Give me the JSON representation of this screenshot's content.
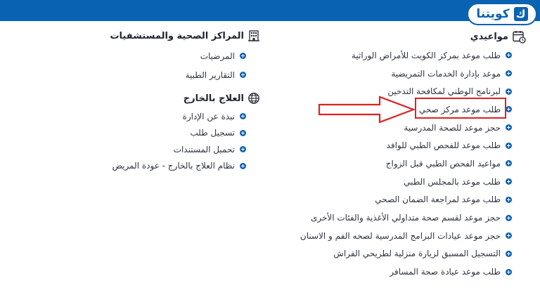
{
  "brand": {
    "logo_text": "كويتنا",
    "logo_mark": "ك",
    "primary_color": "#0a62b3"
  },
  "appointments": {
    "title": "مواعيدي",
    "icon": "calendar-icon",
    "items": [
      {
        "label": "طلب موعد بمركز الكويت للأمراض الوراثية"
      },
      {
        "label": "موعد بإدارة الخدمات التمريضية"
      },
      {
        "label": "لبرنامج الوطني لمكافحة التدخين"
      },
      {
        "label": "طلب موعد مركز صحي"
      },
      {
        "label": "حجز موعد للصحة المدرسية"
      },
      {
        "label": "طلب موعد للفحص الطبي للوافد"
      },
      {
        "label": "مواعيد الفحص الطبي قبل الزواج"
      },
      {
        "label": "طلب موعد بالمجلس الطبي"
      },
      {
        "label": "طلب موعد لمراجعة الضمان الصحي"
      },
      {
        "label": "حجز موعد لقسم صحة متداولي الأغذية والفئات الأخرى"
      },
      {
        "label": "حجز موعد عيادات البرامج المدرسية لصحه الفم و الاسنان"
      },
      {
        "label": "التسجيل المسبق لزيارة منزلية لطريحي الفراش"
      },
      {
        "label": "طلب موعد عيادة صحة المسافر"
      }
    ]
  },
  "health_centers": {
    "title": "المراكز الصحية والمستشفيات",
    "icon": "hospital-building-icon",
    "items": [
      {
        "label": "المرضيات"
      },
      {
        "label": "التقارير الطبية"
      }
    ]
  },
  "treatment_abroad": {
    "title": "العلاج بالخارج",
    "icon": "globe-icon",
    "items": [
      {
        "label": "نبذة عن الإدارة"
      },
      {
        "label": "تسجيل طلب"
      },
      {
        "label": "تحميل المستندات"
      },
      {
        "label": "نظام العلاج بالخارج - عودة المريض"
      }
    ]
  },
  "annotation": {
    "highlight_color": "#e02020"
  }
}
